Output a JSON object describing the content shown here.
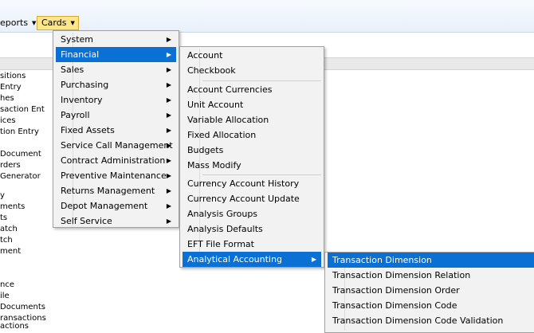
{
  "menubar": {
    "reports_label": "eports",
    "cards_label": "Cards"
  },
  "background_list": [
    "sitions",
    "Entry",
    "hes",
    "saction Ent",
    "ices",
    "tion Entry",
    "",
    "Document",
    "rders",
    "Generator",
    "",
    "y",
    "ments",
    "ts",
    "atch",
    "tch",
    "ment",
    "",
    "",
    "",
    "nce",
    "ile",
    "Documents",
    "ransactions",
    "actions"
  ],
  "cards_menu": [
    {
      "label": "System"
    },
    {
      "label": "Financial"
    },
    {
      "label": "Sales"
    },
    {
      "label": "Purchasing"
    },
    {
      "label": "Inventory"
    },
    {
      "label": "Payroll"
    },
    {
      "label": "Fixed Assets"
    },
    {
      "label": "Service Call Management"
    },
    {
      "label": "Contract Administration"
    },
    {
      "label": "Preventive Maintenance"
    },
    {
      "label": "Returns Management"
    },
    {
      "label": "Depot Management"
    },
    {
      "label": "Self Service"
    }
  ],
  "financial_menu": [
    {
      "label": "Account"
    },
    {
      "label": "Checkbook"
    },
    {
      "label": "Account Currencies"
    },
    {
      "label": "Unit Account"
    },
    {
      "label": "Variable Allocation"
    },
    {
      "label": "Fixed Allocation"
    },
    {
      "label": "Budgets"
    },
    {
      "label": "Mass Modify"
    },
    {
      "label": "Currency Account History"
    },
    {
      "label": "Currency Account Update"
    },
    {
      "label": "Analysis Groups"
    },
    {
      "label": "Analysis Defaults"
    },
    {
      "label": "EFT File Format"
    },
    {
      "label": "Analytical Accounting"
    }
  ],
  "analytical_menu": [
    {
      "label": "Transaction Dimension"
    },
    {
      "label": "Transaction Dimension Relation"
    },
    {
      "label": "Transaction Dimension Order"
    },
    {
      "label": "Transaction Dimension Code"
    },
    {
      "label": "Transaction Dimension Code Validation"
    }
  ],
  "colors": {
    "selection": "#0a70d4",
    "cards_highlight": "#fde58c"
  },
  "icons": {
    "submenu_arrow": "chevron-right-icon",
    "dropdown_caret": "caret-down-icon"
  }
}
